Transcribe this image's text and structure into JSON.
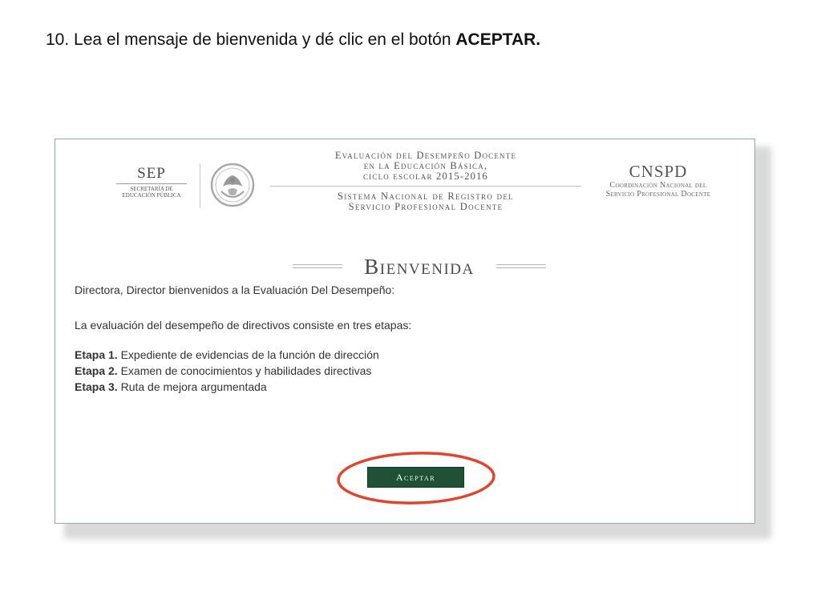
{
  "instruction": {
    "prefix": "10. Lea el mensaje de bienvenida y dé clic en el botón ",
    "emphasis": "ACEPTAR."
  },
  "header": {
    "sep": {
      "title": "SEP",
      "subtitle_line1": "Secretaría de",
      "subtitle_line2": "Educación Pública"
    },
    "evaluation": {
      "line1": "Evaluación del Desempeño Docente",
      "line2": "en la Educación Básica,",
      "line3": "ciclo escolar 2015-2016"
    },
    "system": {
      "line1": "Sistema Nacional de Registro del",
      "line2": "Servicio Profesional Docente"
    },
    "cnspd": {
      "title": "CNSPD",
      "line1": "Coordinación Nacional del",
      "line2": "Servicio Profesional Docente"
    }
  },
  "welcome": {
    "title": "Bienvenida",
    "greeting": "Directora, Director bienvenidos a la Evaluación Del Desempeño:",
    "intro": "La evaluación del desempeño de directivos consiste en tres etapas:",
    "stages": [
      {
        "label": "Etapa 1.",
        "text": "Expediente de evidencias de la función de dirección"
      },
      {
        "label": "Etapa 2.",
        "text": "Examen de conocimientos y habilidades directivas"
      },
      {
        "label": "Etapa 3.",
        "text": "Ruta de mejora argumentada"
      }
    ]
  },
  "accept_button": {
    "label": "Aceptar"
  },
  "colors": {
    "button": "#1e5135",
    "highlight": "#e0452f",
    "frame_border": "#8aa6c8"
  }
}
